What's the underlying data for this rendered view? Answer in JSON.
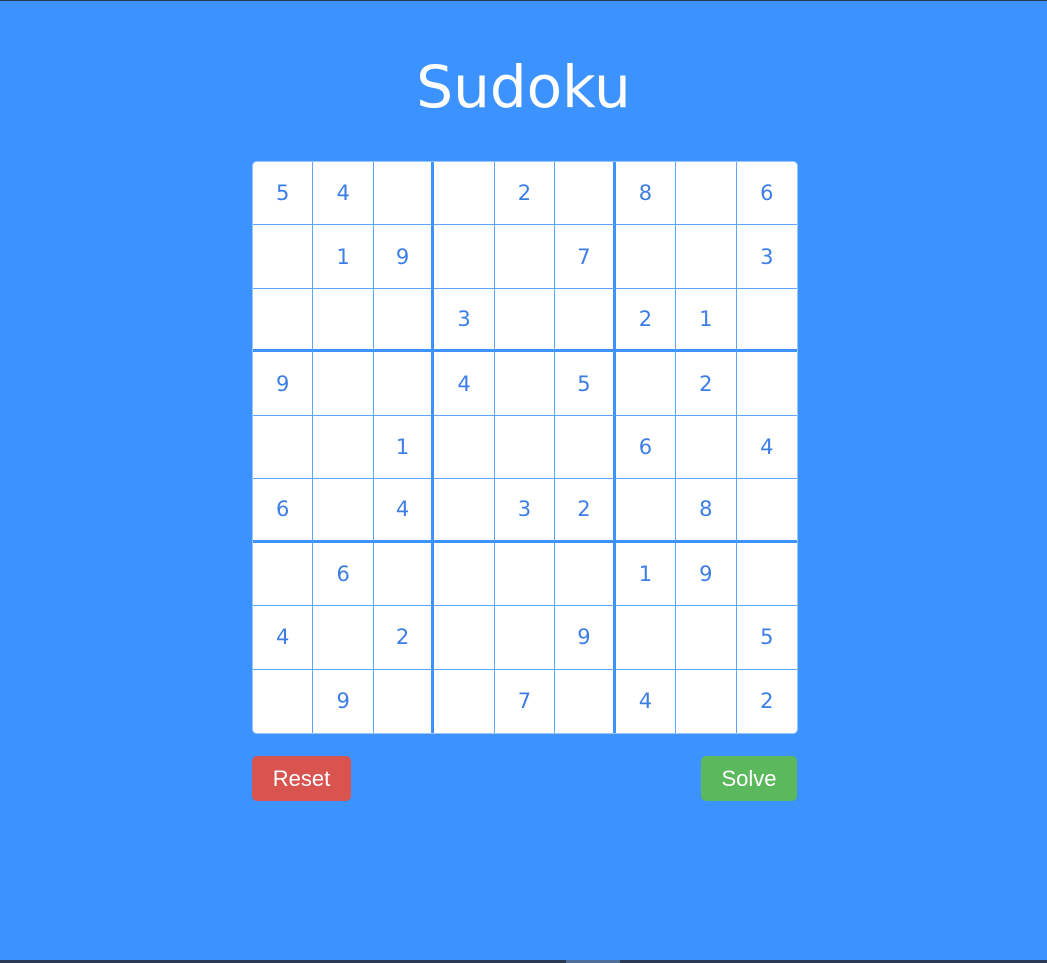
{
  "page": {
    "title": "Sudoku"
  },
  "board": {
    "rows": [
      [
        "5",
        "4",
        "",
        "",
        "2",
        "",
        "8",
        "",
        "6"
      ],
      [
        "",
        "1",
        "9",
        "",
        "",
        "7",
        "",
        "",
        "3"
      ],
      [
        "",
        "",
        "",
        "3",
        "",
        "",
        "2",
        "1",
        ""
      ],
      [
        "9",
        "",
        "",
        "4",
        "",
        "5",
        "",
        "2",
        ""
      ],
      [
        "",
        "",
        "1",
        "",
        "",
        "",
        "6",
        "",
        "4"
      ],
      [
        "6",
        "",
        "4",
        "",
        "3",
        "2",
        "",
        "8",
        ""
      ],
      [
        "",
        "6",
        "",
        "",
        "",
        "",
        "1",
        "9",
        ""
      ],
      [
        "4",
        "",
        "2",
        "",
        "",
        "9",
        "",
        "",
        "5"
      ],
      [
        "",
        "9",
        "",
        "",
        "7",
        "",
        "4",
        "",
        "2"
      ]
    ]
  },
  "actions": {
    "reset_label": "Reset",
    "solve_label": "Solve"
  },
  "colors": {
    "background": "#3c92fe",
    "title_text": "#ffffff",
    "cell_text": "#3d7ee6",
    "grid_line": "#5ea5ff",
    "reset_button": "#d9534f",
    "solve_button": "#5cb85c"
  }
}
